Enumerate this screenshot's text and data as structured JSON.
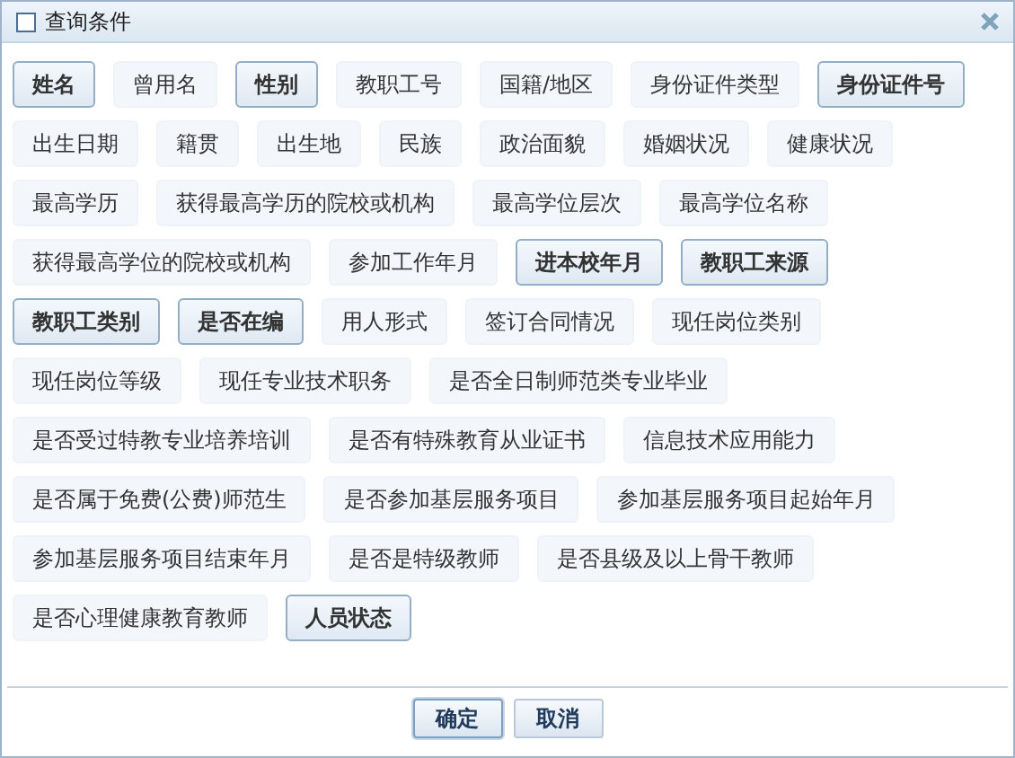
{
  "window": {
    "title": "查询条件"
  },
  "field_rows": [
    [
      {
        "label": "姓名",
        "selected": true
      },
      {
        "label": "曾用名",
        "selected": false
      },
      {
        "label": "性别",
        "selected": true
      },
      {
        "label": "教职工号",
        "selected": false
      },
      {
        "label": "国籍/地区",
        "selected": false
      },
      {
        "label": "身份证件类型",
        "selected": false
      },
      {
        "label": "身份证件号",
        "selected": true
      }
    ],
    [
      {
        "label": "出生日期",
        "selected": false
      },
      {
        "label": "籍贯",
        "selected": false
      },
      {
        "label": "出生地",
        "selected": false
      },
      {
        "label": "民族",
        "selected": false
      },
      {
        "label": "政治面貌",
        "selected": false
      },
      {
        "label": "婚姻状况",
        "selected": false
      },
      {
        "label": "健康状况",
        "selected": false
      }
    ],
    [
      {
        "label": "最高学历",
        "selected": false
      },
      {
        "label": "获得最高学历的院校或机构",
        "selected": false
      },
      {
        "label": "最高学位层次",
        "selected": false
      },
      {
        "label": "最高学位名称",
        "selected": false
      }
    ],
    [
      {
        "label": "获得最高学位的院校或机构",
        "selected": false
      },
      {
        "label": "参加工作年月",
        "selected": false
      },
      {
        "label": "进本校年月",
        "selected": true
      },
      {
        "label": "教职工来源",
        "selected": true
      }
    ],
    [
      {
        "label": "教职工类别",
        "selected": true
      },
      {
        "label": "是否在编",
        "selected": true
      },
      {
        "label": "用人形式",
        "selected": false
      },
      {
        "label": "签订合同情况",
        "selected": false
      },
      {
        "label": "现任岗位类别",
        "selected": false
      }
    ],
    [
      {
        "label": "现任岗位等级",
        "selected": false
      },
      {
        "label": "现任专业技术职务",
        "selected": false
      },
      {
        "label": "是否全日制师范类专业毕业",
        "selected": false
      }
    ],
    [
      {
        "label": "是否受过特教专业培养培训",
        "selected": false
      },
      {
        "label": "是否有特殊教育从业证书",
        "selected": false
      },
      {
        "label": "信息技术应用能力",
        "selected": false
      }
    ],
    [
      {
        "label": "是否属于免费(公费)师范生",
        "selected": false
      },
      {
        "label": "是否参加基层服务项目",
        "selected": false
      },
      {
        "label": "参加基层服务项目起始年月",
        "selected": false
      }
    ],
    [
      {
        "label": "参加基层服务项目结束年月",
        "selected": false
      },
      {
        "label": "是否是特级教师",
        "selected": false
      },
      {
        "label": "是否县级及以上骨干教师",
        "selected": false
      }
    ],
    [
      {
        "label": "是否心理健康教育教师",
        "selected": false
      },
      {
        "label": "人员状态",
        "selected": true
      }
    ]
  ],
  "buttons": [
    {
      "label": "确定",
      "selected": true
    },
    {
      "label": "取消",
      "selected": false
    }
  ]
}
